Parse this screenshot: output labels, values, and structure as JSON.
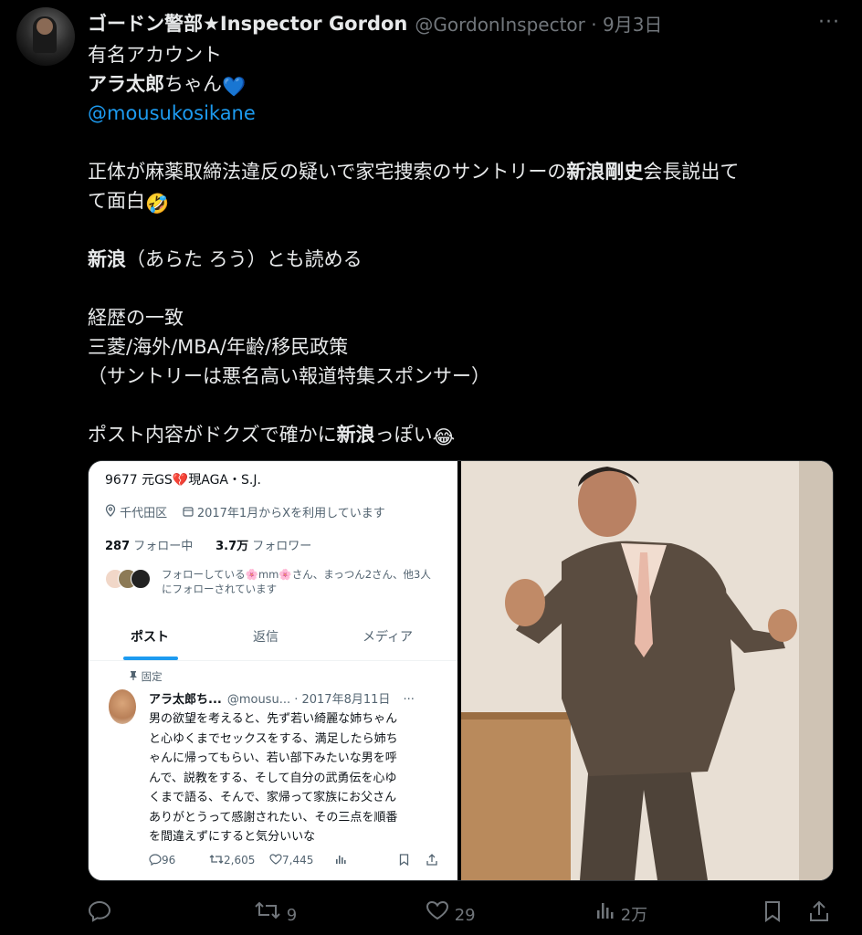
{
  "post": {
    "author_name": "ゴードン警部★Inspector Gordon",
    "handle": "@GordonInspector",
    "date": "9月3日",
    "more": "···",
    "lines": {
      "l1": "有名アカウント",
      "l2_bold": "アラ太郎",
      "l2_rest": "ちゃん",
      "mention": "@mousukosikane",
      "l4a": "正体が麻薬取締法違反の疑いで家宅捜索のサントリーの",
      "l4_bold": "新浪剛史",
      "l4b": "会長説出て",
      "l5": "て面白",
      "l6_bold": "新浪",
      "l6_rest": "（あらた ろう）とも読める",
      "l7": "経歴の一致",
      "l8": "三菱/海外/MBA/年齢/移民政策",
      "l9": "（サントリーは悪名高い報道特集スポンサー）",
      "l10a": "ポスト内容がドクズで確かに",
      "l10_bold": "新浪",
      "l10b": "っぽい"
    },
    "emojis": {
      "heart": "💙",
      "rofl": "🤣",
      "joy": "😂"
    }
  },
  "embedded_profile": {
    "title": "9677 元GS💔現AGA・S.J.",
    "location": "千代田区",
    "joined": "2017年1月からXを利用しています",
    "following_count": "287",
    "following_label": "フォロー中",
    "followers_count": "3.7万",
    "followers_label": "フォロワー",
    "followed_by": "フォローしている🌸mm🌸さん、まっつん2さん、他3人にフォローされています",
    "tabs": [
      "ポスト",
      "返信",
      "メディア"
    ],
    "pinned_label": "固定",
    "post": {
      "name": "アラ太郎ち...",
      "handle_date": "@mousu... · 2017年8月11日",
      "more": "···",
      "text_lines": [
        "男の欲望を考えると、先ず若い綺麗な姉ちゃん",
        "と心ゆくまでセックスをする、満足したら姉ち",
        "ゃんに帰ってもらい、若い部下みたいな男を呼",
        "んで、説教をする、そして自分の武勇伝を心ゆ",
        "くまで語る、そんで、家帰って家族にお父さん",
        "ありがとうって感謝されたい、その三点を順番",
        "を間違えずにすると気分いいな"
      ],
      "replies": "96",
      "reposts": "2,605",
      "likes": "7,445"
    }
  },
  "actions": {
    "reply_count": "",
    "repost_count": "9",
    "like_count": "29",
    "views_count": "2万"
  }
}
